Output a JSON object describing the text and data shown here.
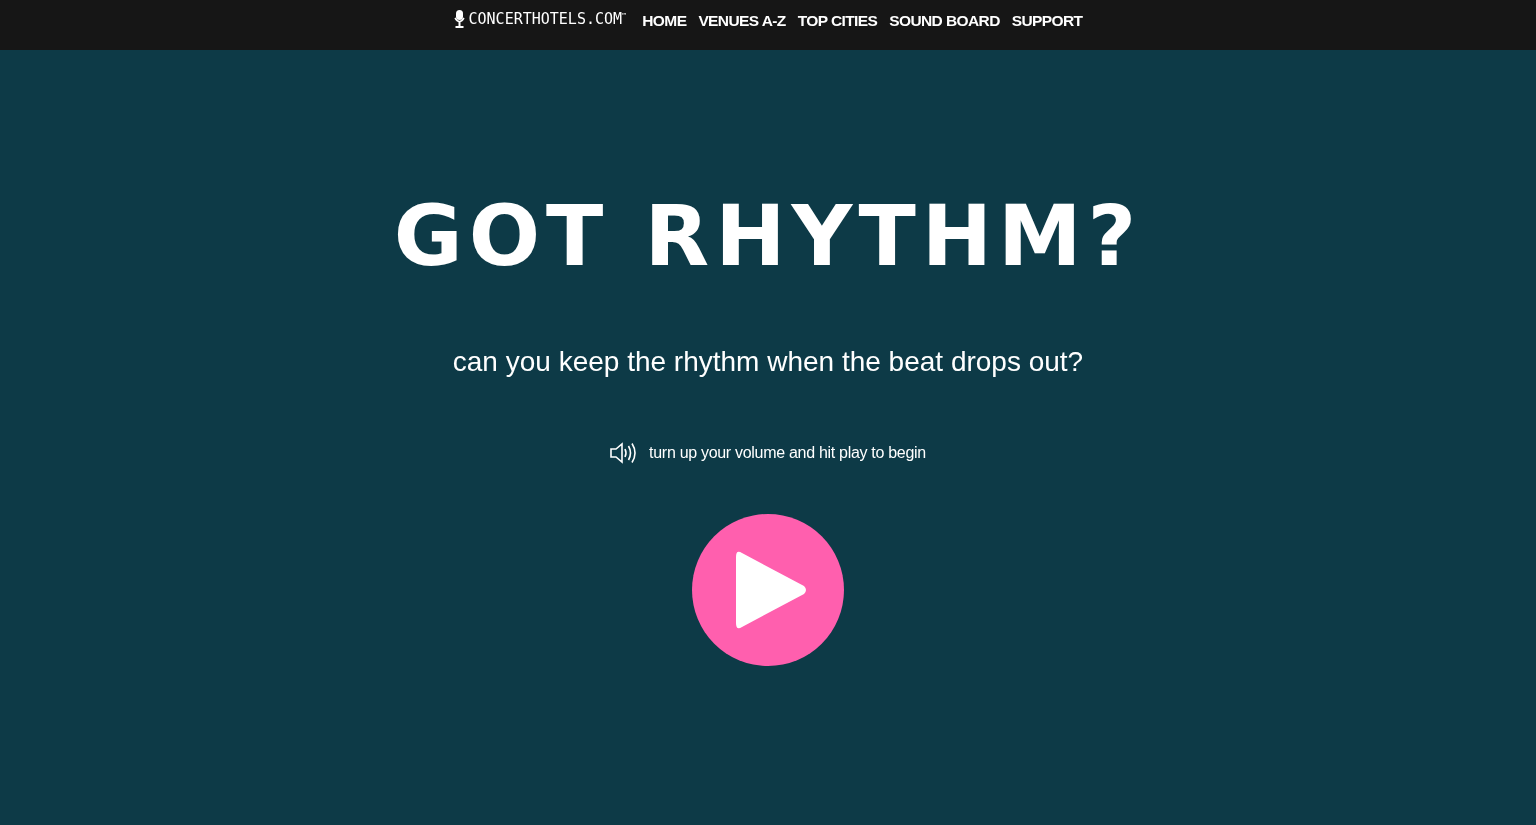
{
  "header": {
    "logo": "CONCERTHOTELS.COM$^{™}$",
    "nav": [
      {
        "label": "HOME"
      },
      {
        "label": "VENUES A-Z"
      },
      {
        "label": "TOP CITIES"
      },
      {
        "label": "SOUND BOARD"
      },
      {
        "label": "SUPPORT"
      }
    ]
  },
  "hero": {
    "title": "GOT RHYTHM?",
    "subtitle": "can you keep the rhythm when the beat drops out?",
    "hint": "turn up your volume and hit play to begin"
  }
}
